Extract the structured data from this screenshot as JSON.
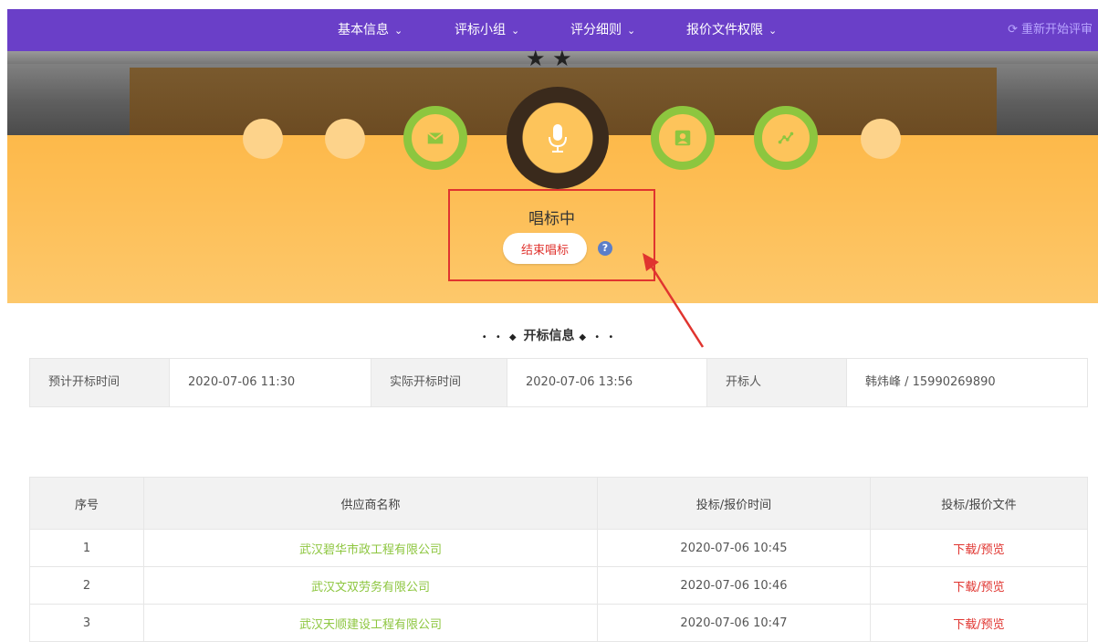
{
  "nav": {
    "items": [
      {
        "label": "基本信息"
      },
      {
        "label": "评标小组"
      },
      {
        "label": "评分细则"
      },
      {
        "label": "报价文件权限"
      }
    ],
    "restart_label": "重新开始评审"
  },
  "hero": {
    "status": "唱标中",
    "end_button": "结束唱标",
    "help": "?",
    "steps": [
      "blank",
      "blank",
      "envelope-icon",
      "microphone-icon",
      "user-icon",
      "chart-icon",
      "blank"
    ]
  },
  "section": {
    "title": "开标信息"
  },
  "info": {
    "expected_label": "预计开标时间",
    "expected_value": "2020-07-06 11:30",
    "actual_label": "实际开标时间",
    "actual_value": "2020-07-06 13:56",
    "opener_label": "开标人",
    "opener_value": "韩炜峰 / 15990269890"
  },
  "bids": {
    "headers": [
      "序号",
      "供应商名称",
      "投标/报价时间",
      "投标/报价文件"
    ],
    "rows": [
      {
        "no": "1",
        "supplier": "武汉碧华市政工程有限公司",
        "time": "2020-07-06 10:45",
        "file": "下载/预览"
      },
      {
        "no": "2",
        "supplier": "武汉文双劳务有限公司",
        "time": "2020-07-06 10:46",
        "file": "下载/预览"
      },
      {
        "no": "3",
        "supplier": "武汉天顺建设工程有限公司",
        "time": "2020-07-06 10:47",
        "file": "下载/预览"
      }
    ]
  },
  "colors": {
    "nav": "#6a3fc8",
    "accent_green": "#8dc63f",
    "accent_red": "#e0342f",
    "hero": "#fdc05a"
  }
}
